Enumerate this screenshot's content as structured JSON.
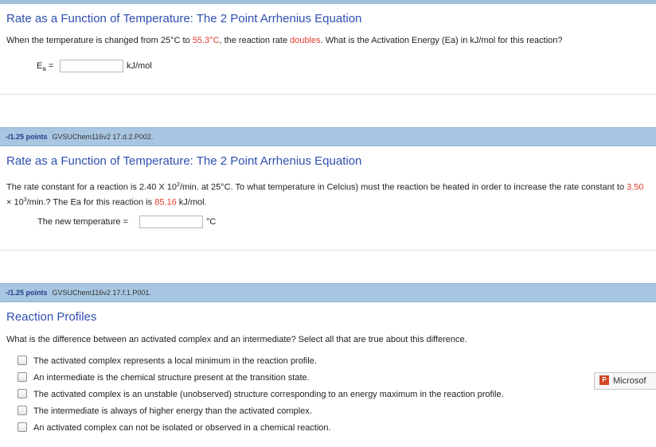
{
  "q1": {
    "title": "Rate as a Function of Temperature: The 2 Point Arrhenius Equation",
    "text_a": "When the temperature is changed from 25°C to ",
    "red_temp": "55.3°C",
    "text_b": ", the reaction rate ",
    "red_doubles": "doubles",
    "text_c": ". What is the Activation Energy (Ea) in kJ/mol for this reaction?",
    "label_main": "E",
    "label_sub": "a",
    "label_eq": " =",
    "input_value": "",
    "unit": "kJ/mol"
  },
  "q2": {
    "points": "-/1.25 points",
    "code": "GVSUChem116v2 17.d.2.P002.",
    "title": "Rate as a Function of Temperature: The 2 Point Arrhenius Equation",
    "text_a": "The rate constant for a reaction is 2.40 X 10",
    "sup_a": "2",
    "text_b": "/min. at 25°C. To what temperature in Celcius) must the reaction be heated in order to increase the rate constant to ",
    "red_k": "3.50",
    "text_c": " × 10",
    "sup_c": "3",
    "text_d": "/min.? The Ea for this reaction is ",
    "red_ea": "85.16",
    "text_e": " kJ/mol.",
    "label": "The new temperature =",
    "input_value": "",
    "unit": "°C"
  },
  "q3": {
    "points": "-/1.25 points",
    "code": "GVSUChem116v2 17.f.1.P001.",
    "title": "Reaction Profiles",
    "text": "What is the difference between an activated complex and an intermediate? Select all that are true about this difference.",
    "options": [
      "The activated complex represents a local minimum in the reaction profile.",
      "An intermediate is the chemical structure present at the transition state.",
      "The activated complex is an unstable (unobserved) structure corresponding to an energy maximum in the reaction profile.",
      "The intermediate is always of higher energy than the activated complex.",
      "An activated complex can not be isolated or observed in a chemical reaction."
    ]
  },
  "office_button": {
    "label": "Microsof",
    "icon": "powerpoint-icon"
  }
}
